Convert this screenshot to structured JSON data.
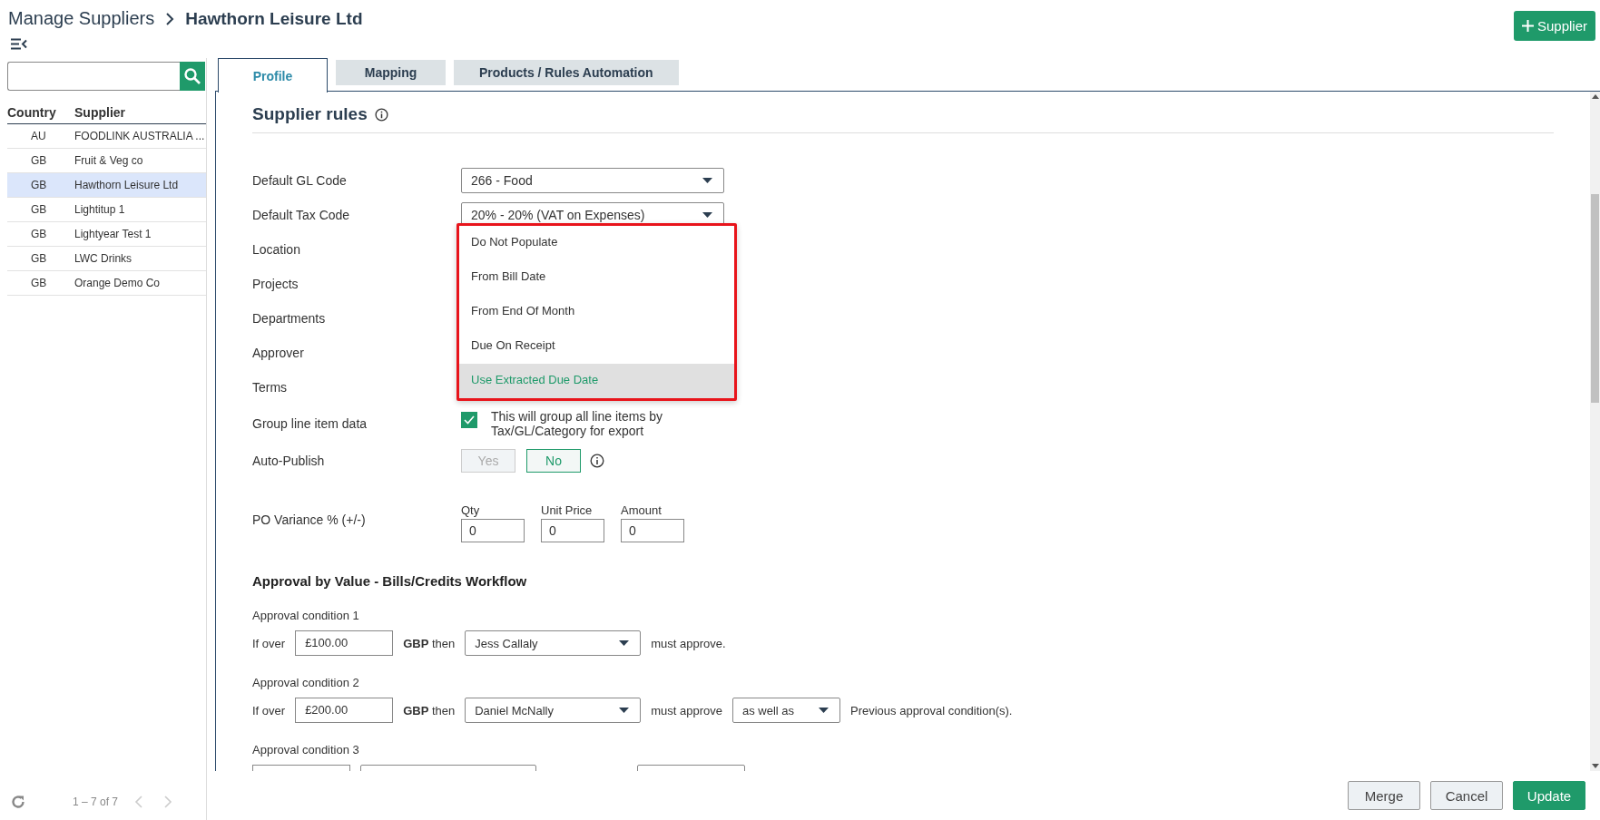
{
  "breadcrumb": {
    "parent": "Manage Suppliers",
    "current": "Hawthorn Leisure Ltd"
  },
  "add_button": "Supplier",
  "sidebar": {
    "columns": [
      "Country",
      "Supplier"
    ],
    "rows": [
      {
        "country": "AU",
        "supplier": "FOODLINK AUSTRALIA ...",
        "selected": false
      },
      {
        "country": "GB",
        "supplier": "Fruit & Veg co",
        "selected": false
      },
      {
        "country": "GB",
        "supplier": "Hawthorn Leisure Ltd",
        "selected": true
      },
      {
        "country": "GB",
        "supplier": "Lightitup 1",
        "selected": false
      },
      {
        "country": "GB",
        "supplier": "Lightyear Test 1",
        "selected": false
      },
      {
        "country": "GB",
        "supplier": "LWC Drinks",
        "selected": false
      },
      {
        "country": "GB",
        "supplier": "Orange Demo Co",
        "selected": false
      }
    ],
    "pagination": "1 – 7 of 7"
  },
  "tabs": [
    {
      "label": "Profile",
      "selected": true
    },
    {
      "label": "Mapping",
      "selected": false
    },
    {
      "label": "Products / Rules Automation",
      "selected": false
    }
  ],
  "section_title": "Supplier rules",
  "fields": [
    {
      "kind": "select",
      "label": "Default GL Code",
      "value": "266 - Food"
    },
    {
      "kind": "select",
      "label": "Default Tax Code",
      "value": "20% - 20% (VAT on Expenses)"
    },
    {
      "kind": "plain",
      "label": "Location"
    },
    {
      "kind": "plain",
      "label": "Projects"
    },
    {
      "kind": "plain",
      "label": "Departments"
    },
    {
      "kind": "plain",
      "label": "Approver"
    },
    {
      "kind": "plain",
      "label": "Terms"
    },
    {
      "kind": "checkbox",
      "label": "Group line item data",
      "checked": true,
      "text": "This will group all line items by Tax/GL/Category for export"
    },
    {
      "kind": "toggle",
      "label": "Auto-Publish",
      "options": [
        {
          "label": "Yes",
          "selected": false
        },
        {
          "label": "No",
          "selected": true
        }
      ]
    },
    {
      "kind": "variance",
      "label": "PO Variance % (+/-)",
      "inputs": [
        {
          "label": "Qty",
          "value": "0"
        },
        {
          "label": "Unit Price",
          "value": "0"
        },
        {
          "label": "Amount",
          "value": "0"
        }
      ]
    }
  ],
  "dropdown": {
    "options": [
      {
        "label": "Do Not Populate",
        "selected": false
      },
      {
        "label": "From Bill Date",
        "selected": false
      },
      {
        "label": "From End Of Month",
        "selected": false
      },
      {
        "label": "Due On Receipt",
        "selected": false
      },
      {
        "label": "Use Extracted Due Date",
        "selected": true
      }
    ]
  },
  "approval": {
    "title": "Approval by Value - Bills/Credits Workflow",
    "conditions": [
      {
        "label": "Approval condition 1",
        "prefix": "If over",
        "amount": "£100.00",
        "then": "**GBP** then",
        "approver": "Jess Callaly",
        "suffix": "must approve."
      },
      {
        "label": "Approval condition 2",
        "prefix": "If over",
        "amount": "£200.00",
        "then": "**GBP** then",
        "approver": "Daniel McNally",
        "suffix": "must approve",
        "mode": "as well as",
        "tail": "Previous approval condition(s)."
      },
      {
        "label": "Approval condition 3"
      }
    ]
  },
  "footer_buttons": [
    {
      "label": "Merge",
      "kind": "secondary"
    },
    {
      "label": "Cancel",
      "kind": "secondary"
    },
    {
      "label": "Update",
      "kind": "primary"
    }
  ]
}
